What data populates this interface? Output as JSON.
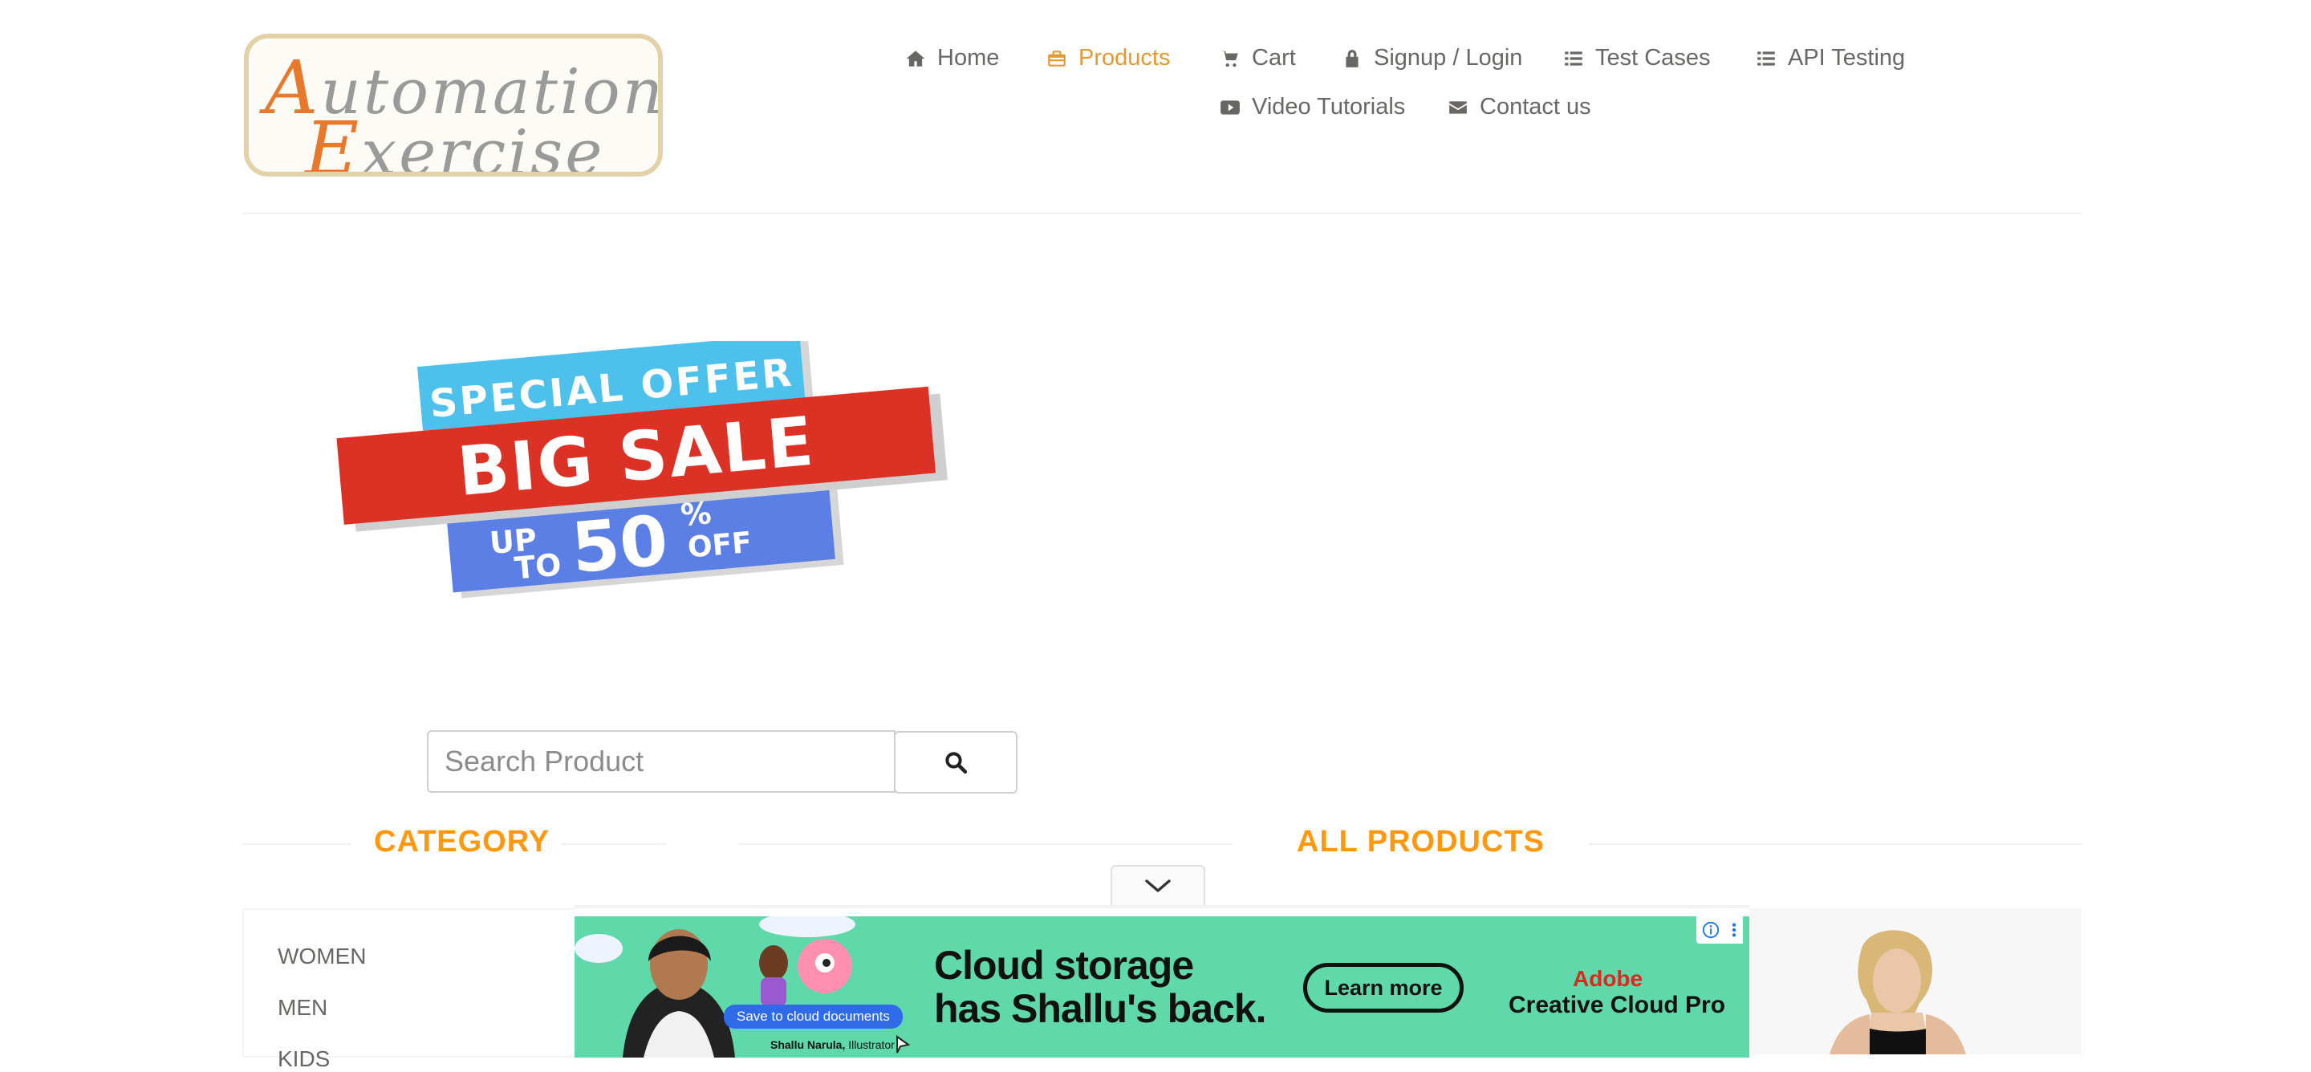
{
  "logo": {
    "line1_cap": "A",
    "line1_rest": "utomation",
    "line2_cap": "E",
    "line2_rest": "xercise"
  },
  "nav": {
    "items": [
      {
        "label": "Home",
        "icon": "home-icon"
      },
      {
        "label": "Products",
        "icon": "briefcase-icon",
        "active": true
      },
      {
        "label": "Cart",
        "icon": "cart-icon"
      },
      {
        "label": "Signup / Login",
        "icon": "lock-icon"
      },
      {
        "label": "Test Cases",
        "icon": "list-icon"
      },
      {
        "label": "API Testing",
        "icon": "list-icon"
      },
      {
        "label": "Video Tutorials",
        "icon": "youtube-play-icon"
      },
      {
        "label": "Contact us",
        "icon": "envelope-icon"
      }
    ],
    "active_color": "#e29a31"
  },
  "banner": {
    "line1": "SPECIAL OFFER",
    "line2": "BIG SALE",
    "up": "UP",
    "to": "TO",
    "pct": "50",
    "percent_sign": "%",
    "off": "OFF"
  },
  "search": {
    "placeholder": "Search Product",
    "value": "",
    "button_icon": "search-icon"
  },
  "category": {
    "title": "CATEGORY",
    "items": [
      "WOMEN",
      "MEN",
      "KIDS"
    ]
  },
  "products": {
    "title": "ALL PRODUCTS"
  },
  "ad": {
    "headline_line1": "Cloud storage",
    "headline_line2": "has Shallu's back.",
    "cta": "Learn more",
    "brand_line1": "Adobe",
    "brand_line2": "Creative Cloud Pro",
    "pill": "Save to cloud documents",
    "credit_name": "Shallu Narula,",
    "credit_role": "Illustrator",
    "background_color": "#5fd9a9"
  },
  "colors": {
    "accent": "#fe980f",
    "text": "#696763"
  }
}
